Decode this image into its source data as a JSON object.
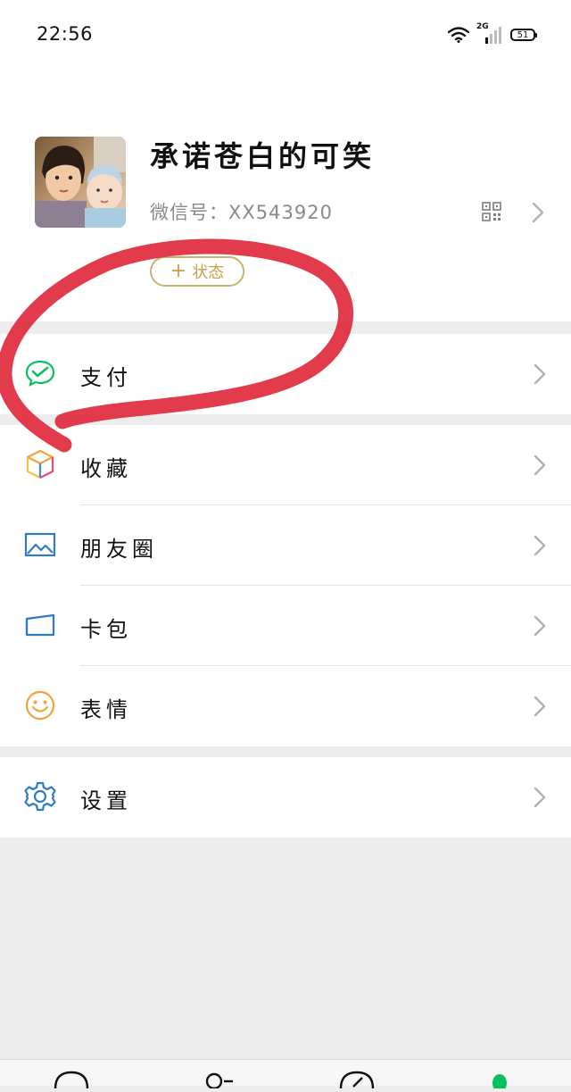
{
  "status_bar": {
    "time": "22:56",
    "network_type": "2G",
    "battery": "51",
    "icons": [
      "wifi-icon",
      "signal-icon",
      "battery-icon"
    ]
  },
  "profile": {
    "name": "承诺苍白的可笑",
    "wechat_id": "微信号：XX543920",
    "status_button": "状态",
    "icons": [
      "qr-code-icon",
      "chevron-right-icon",
      "plus-icon"
    ]
  },
  "menu": {
    "pay": {
      "label": "支付",
      "icon": "wechat-pay-icon"
    },
    "favorites": {
      "label": "收藏",
      "icon": "cube-icon"
    },
    "moments": {
      "label": "朋友圈",
      "icon": "picture-icon"
    },
    "cards": {
      "label": "卡包",
      "icon": "wallet-icon"
    },
    "stickers": {
      "label": "表情",
      "icon": "smile-icon"
    },
    "settings": {
      "label": "设置",
      "icon": "gear-icon"
    }
  },
  "tabbar": {
    "icons": [
      "chat-icon",
      "contacts-icon",
      "discover-icon",
      "me-icon"
    ]
  },
  "colors": {
    "accent_green": "#07c160",
    "annotation_red": "#e02a3c",
    "status_gold": "#c8a24f",
    "background": "#ededed"
  }
}
